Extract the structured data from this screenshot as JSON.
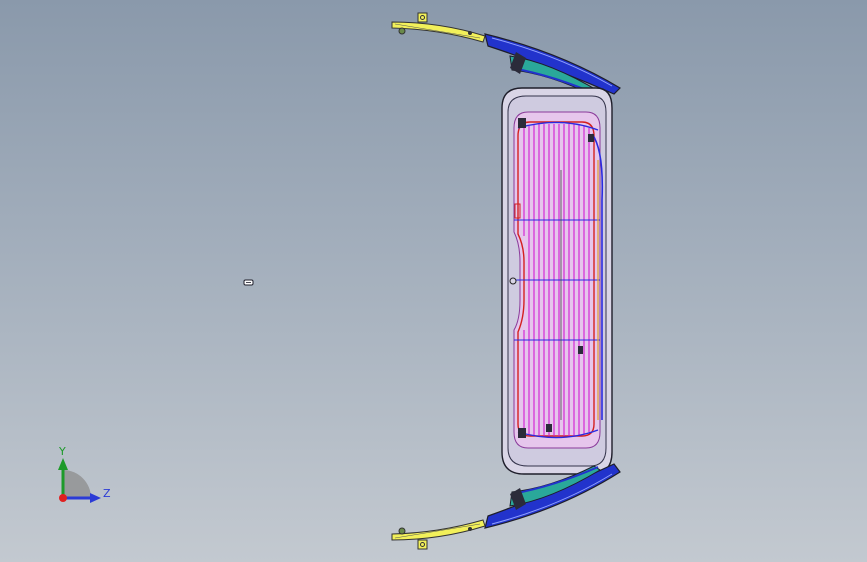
{
  "view": {
    "name": "cad-3d-viewport",
    "background_top": "#8a99ab",
    "background_bottom": "#c3c9d0"
  },
  "model": {
    "parts": [
      "top-hinge-bracket",
      "top-spoiler-trim",
      "rear-window-glass",
      "defroster-grid",
      "bottom-hinge-bracket",
      "bottom-spoiler-trim",
      "small-clip"
    ],
    "colors": {
      "bracket": "#f2f05a",
      "trim_blue": "#2233cc",
      "trim_teal": "#2aa89a",
      "glass_fill": "#d6d3e6",
      "grid_magenta": "#d21cd2",
      "grid_red": "#d42020",
      "grid_blue": "#2a2ae0",
      "outline": "#1e1e2a"
    }
  },
  "triad": {
    "y_label": "Y",
    "z_label": "Z",
    "colors": {
      "y": "#1d9a2a",
      "z": "#2b3bd6",
      "origin": "#e02020"
    }
  }
}
